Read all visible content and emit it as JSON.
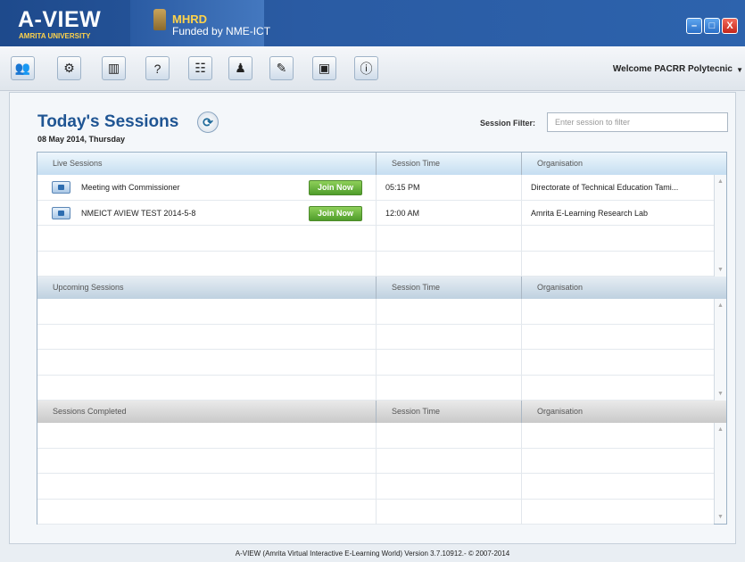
{
  "header": {
    "logo": "A-VIEW",
    "logo_sub": "AMRITA UNIVERSITY",
    "mhrd": "MHRD",
    "funded": "Funded by NME-ICT",
    "window_minimize": "–",
    "window_maximize": "□",
    "window_close": "X"
  },
  "toolbar": {
    "icons": [
      "users-icon",
      "network-icon",
      "library-icon",
      "quiz-icon",
      "contacts-icon",
      "teacher-icon",
      "notes-icon",
      "box-icon",
      "help-icon"
    ],
    "welcome": "Welcome PACRR Polytecnic"
  },
  "page": {
    "title": "Today's Sessions",
    "date": "08 May 2014, Thursday",
    "filter_label": "Session Filter:",
    "filter_placeholder": "Enter session to filter"
  },
  "live": {
    "headers": [
      "Live Sessions",
      "Session Time",
      "Organisation"
    ],
    "rows": [
      {
        "name": "Meeting with Commissioner",
        "action": "Join Now",
        "time": "05:15 PM",
        "org": "Directorate of Technical Education Tami..."
      },
      {
        "name": "NMEICT AVIEW TEST 2014-5-8",
        "action": "Join Now",
        "time": "12:00 AM",
        "org": "Amrita E-Learning Research Lab"
      }
    ]
  },
  "upcoming": {
    "headers": [
      "Upcoming Sessions",
      "Session Time",
      "Organisation"
    ]
  },
  "completed": {
    "headers": [
      "Sessions Completed",
      "Session Time",
      "Organisation"
    ]
  },
  "footer": "A-VIEW (Amrita Virtual Interactive E-Learning World) Version 3.7.10912.- © 2007-2014",
  "colors": {
    "header_blue": "#2a5ba3",
    "title_blue": "#1f5593",
    "join_green": "#4f9d2b",
    "close_red": "#c4261a"
  }
}
